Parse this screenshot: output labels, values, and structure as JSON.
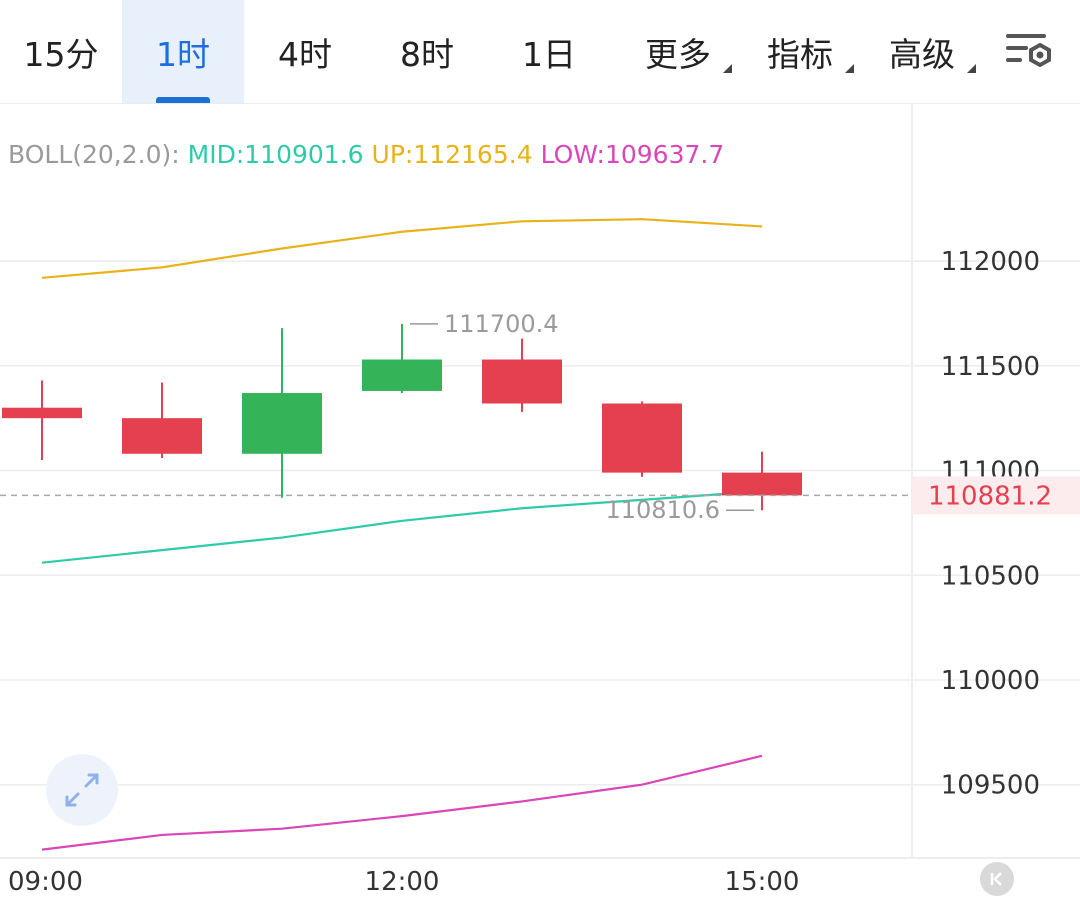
{
  "tabs": [
    {
      "label": "15分",
      "active": false,
      "dropdown": false
    },
    {
      "label": "1时",
      "active": true,
      "dropdown": false
    },
    {
      "label": "4时",
      "active": false,
      "dropdown": false
    },
    {
      "label": "8时",
      "active": false,
      "dropdown": false
    },
    {
      "label": "1日",
      "active": false,
      "dropdown": false
    },
    {
      "label": "更多",
      "active": false,
      "dropdown": true
    },
    {
      "label": "指标",
      "active": false,
      "dropdown": true
    },
    {
      "label": "高级",
      "active": false,
      "dropdown": true
    }
  ],
  "icons": {
    "settings": "chart-settings-icon",
    "expand": "expand-arrows-icon",
    "collapse": "collapse-left-icon"
  },
  "indicator": {
    "name": "BOLL(20,2.0):",
    "mid_label": "MID:110901.6",
    "up_label": "UP:112165.4",
    "low_label": "LOW:109637.7"
  },
  "chart_data": {
    "type": "candlestick",
    "x_ticks": [
      "09:00",
      "12:00",
      "15:00"
    ],
    "y_ticks": [
      109500,
      110000,
      110500,
      111000,
      111500,
      112000
    ],
    "ylim": [
      109150,
      112750
    ],
    "candles": [
      {
        "open": 111300,
        "close": 111250,
        "high": 111430,
        "low": 111050
      },
      {
        "open": 111250,
        "close": 111080,
        "high": 111420,
        "low": 111060
      },
      {
        "open": 111080,
        "close": 111370,
        "high": 111680,
        "low": 110870
      },
      {
        "open": 111380,
        "close": 111530,
        "high": 111700.4,
        "low": 111370
      },
      {
        "open": 111530,
        "close": 111320,
        "high": 111630,
        "low": 111280
      },
      {
        "open": 111320,
        "close": 110990,
        "high": 111330,
        "low": 110970
      },
      {
        "open": 110990,
        "close": 110881.2,
        "high": 111090,
        "low": 110810.6
      }
    ],
    "series": [
      {
        "name": "UP",
        "values": [
          111920,
          111970,
          112060,
          112140,
          112190,
          112200,
          112165.4
        ]
      },
      {
        "name": "MID",
        "values": [
          110560,
          110620,
          110680,
          110760,
          110820,
          110860,
          110901.6
        ]
      },
      {
        "name": "LOW",
        "values": [
          109190,
          109260,
          109290,
          109350,
          109420,
          109500,
          109637.7
        ]
      }
    ],
    "max_label": "111700.4",
    "min_label": "110810.6",
    "last_price": "110881.2",
    "grid": true,
    "colors": {
      "up_candle": "#35b359",
      "down_candle": "#e5404f",
      "boll_up": "#e8b21a",
      "boll_mid": "#2ecaa9",
      "boll_low": "#d946b8",
      "boll_name": "#9a9a9a",
      "last_price": "#e5404f",
      "last_price_bg": "#fdeced",
      "axis_text": "#333333",
      "annotation": "#9a9a9a",
      "grid": "#ededed"
    }
  }
}
